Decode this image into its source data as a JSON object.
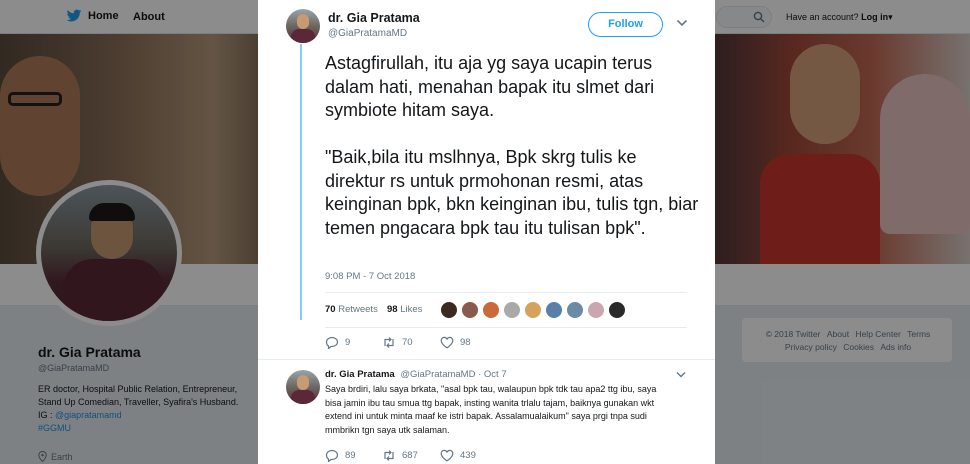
{
  "topnav": {
    "home_label": "Home",
    "about_label": "About",
    "account_prompt": "Have an account?",
    "login_label": "Log in"
  },
  "profile": {
    "name": "dr. Gia Pratama",
    "handle": "@GiaPratamaMD",
    "bio_text": "ER doctor, Hospital Public Relation, Entrepreneur, Stand Up Comedian, Traveller, Syafira's Husband. IG : ",
    "bio_link": "@giapratamamd",
    "bio_hashtag": "#GGMU",
    "location": "Earth"
  },
  "footer": {
    "copyright": "© 2018 Twitter",
    "about": "About",
    "help": "Help Center",
    "terms": "Terms",
    "privacy": "Privacy policy",
    "cookies": "Cookies",
    "ads": "Ads info"
  },
  "tweet": {
    "author_name": "dr. Gia Pratama",
    "author_handle": "@GiaPratamaMD",
    "follow_label": "Follow",
    "paragraph1": "Astagfirullah, itu aja yg saya ucapin terus dalam hati, menahan bapak itu slmet dari symbiote hitam saya.",
    "paragraph2": "\"Baik,bila itu mslhnya, Bpk skrg tulis ke direktur rs untuk prmohonan resmi, atas keinginan bpk, bkn keinginan ibu, tulis tgn, biar temen pngacara bpk tau itu tulisan bpk\".",
    "timestamp": "9:08 PM - 7 Oct 2018",
    "retweets_count": "70",
    "retweets_label": "Retweets",
    "likes_count": "98",
    "likes_label": "Likes",
    "replies": "9",
    "retweets": "70",
    "likes": "98",
    "liker_colors": [
      "#3b2a22",
      "#8a5a4a",
      "#c86a3a",
      "#a9a9a9",
      "#d4a25c",
      "#5a7fa8",
      "#6b8aa6",
      "#c9a6b0",
      "#2a2a2a"
    ]
  },
  "reply": {
    "author_name": "dr. Gia Pratama",
    "author_handle": "@GiaPratamaMD",
    "date": "· Oct 7",
    "text": "Saya brdiri, lalu saya brkata, \"asal bpk tau, walaupun bpk tdk tau apa2 ttg ibu, saya bisa jamin ibu tau smua ttg bapak, insting wanita trlalu tajam, baiknya gunakan wkt extend ini untuk minta maaf ke istri bapak. Assalamualaikum\" saya prgi tnpa sudi mmbrikn tgn saya utk salaman.",
    "replies": "89",
    "retweets": "687",
    "likes": "439"
  }
}
